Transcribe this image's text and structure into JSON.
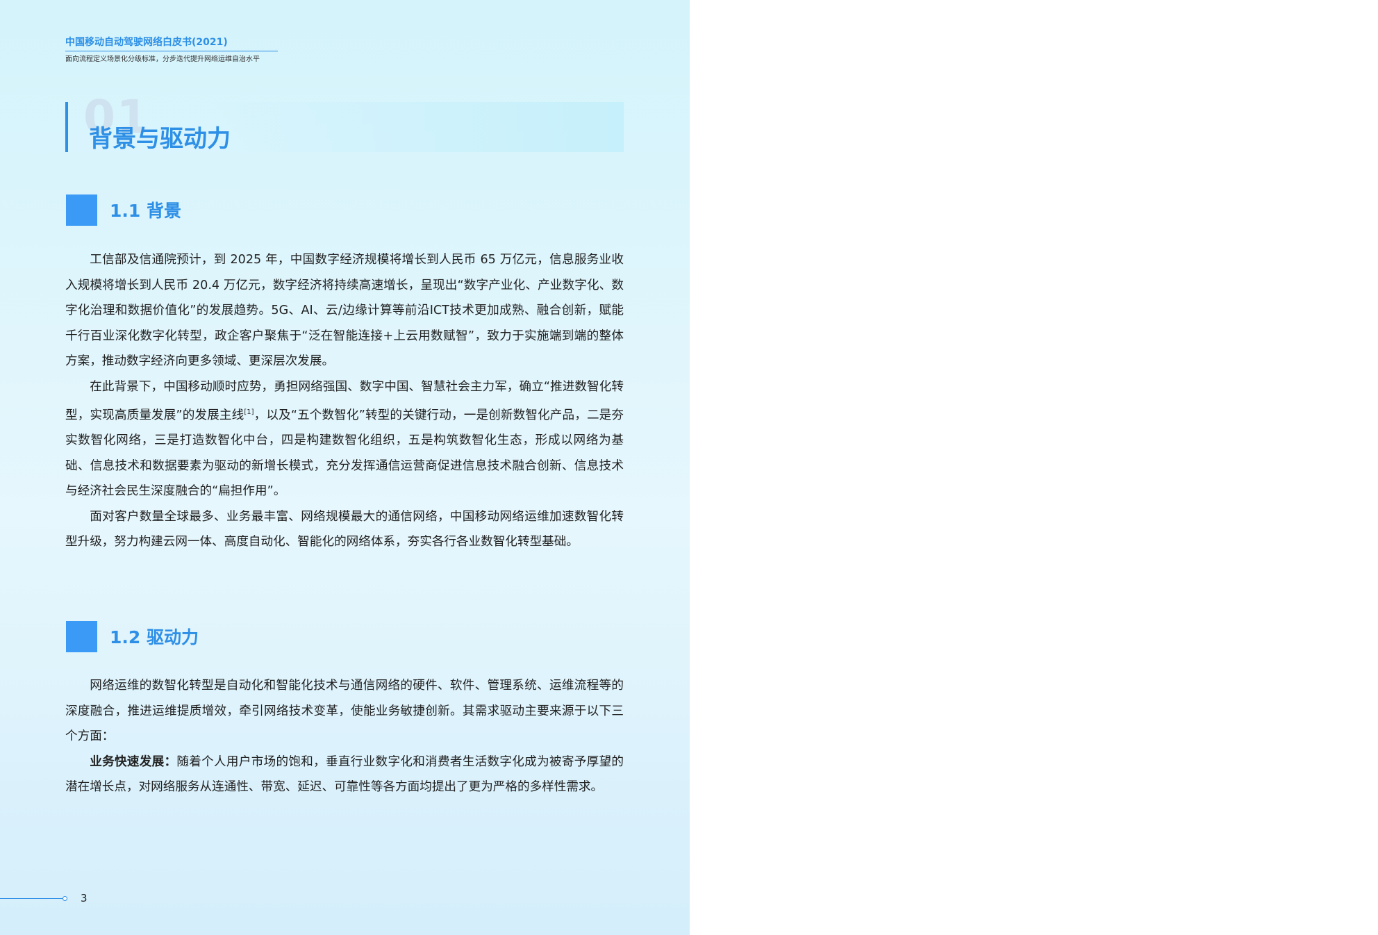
{
  "header": {
    "title": "中国移动自动驾驶网络白皮书(2021)",
    "subtitle": "面向流程定义场景化分级标准，分步迭代提升网络运维自治水平"
  },
  "chapter": {
    "number": "01",
    "title": "背景与驱动力"
  },
  "section1": {
    "title": "1.1 背景",
    "p1": "工信部及信通院预计，到 2025 年，中国数字经济规模将增长到人民币 65 万亿元，信息服务业收入规模将增长到人民币 20.4 万亿元，数字经济将持续高速增长，呈现出“数字产业化、产业数字化、数字化治理和数据价值化”的发展趋势。5G、AI、云/边缘计算等前沿ICT技术更加成熟、融合创新，赋能千行百业深化数字化转型，政企客户聚焦于“泛在智能连接+上云用数赋智”，致力于实施端到端的整体方案，推动数字经济向更多领域、更深层次发展。",
    "p2a": "在此背景下，中国移动顺时应势，勇担网络强国、数字中国、智慧社会主力军，确立“推进数智化转型，实现高质量发展”的发展主线",
    "p2_ref": "[1]",
    "p2b": "，以及“五个数智化”转型的关键行动，一是创新数智化产品，二是夯实数智化网络，三是打造数智化中台，四是构建数智化组织，五是构筑数智化生态，形成以网络为基础、信息技术和数据要素为驱动的新增长模式，充分发挥通信运营商促进信息技术融合创新、信息技术与经济社会民生深度融合的“扁担作用”。",
    "p3": "面对客户数量全球最多、业务最丰富、网络规模最大的通信网络，中国移动网络运维加速数智化转型升级，努力构建云网一体、高度自动化、智能化的网络体系，夯实各行各业数智化转型基础。"
  },
  "section2": {
    "title": "1.2 驱动力",
    "p1": "网络运维的数智化转型是自动化和智能化技术与通信网络的硬件、软件、管理系统、运维流程等的深度融合，推进运维提质增效，牵引网络技术变革，使能业务敏捷创新。其需求驱动主要来源于以下三个方面：",
    "p2_lead": "业务快速发展：",
    "p2": "随着个人用户市场的饱和，垂直行业数字化和消费者生活数字化成为被寄予厚望的潜在增长点，对网络服务从连通性、带宽、延迟、可靠性等各方面均提出了更为严格的多样性需求。"
  },
  "footer": {
    "page_number": "3"
  }
}
